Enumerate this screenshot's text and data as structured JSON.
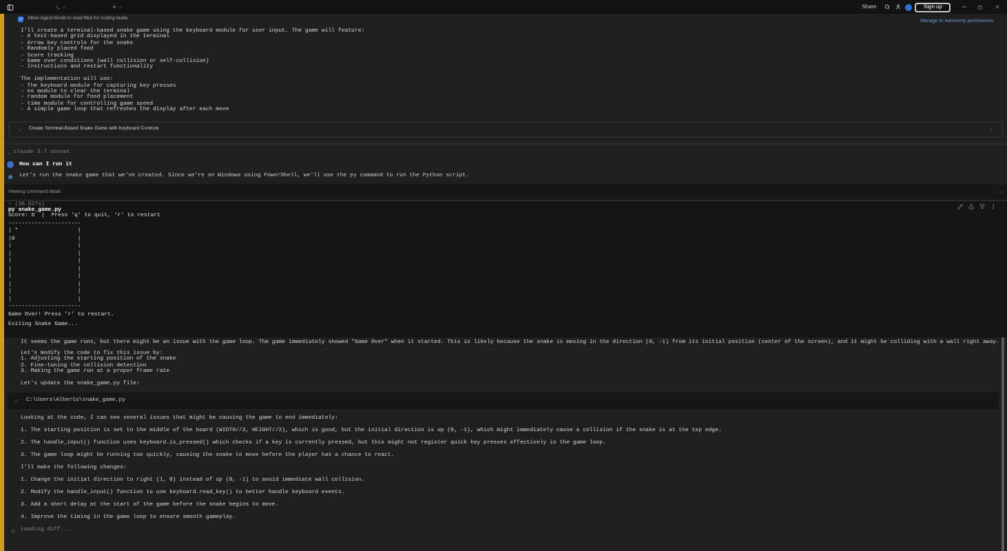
{
  "title_bar": {
    "share": "Share",
    "sign_up": "Sign up"
  },
  "permission": {
    "checkbox_label": "Allow Agent Mode to read files for coding tasks",
    "checked": true,
    "link": "Manage AI Autonomy permissions"
  },
  "plan": {
    "intro": [
      "I'll create a terminal-based snake game using the keyboard module for user input. The game will feature:",
      "- A text-based grid displayed in the terminal",
      "- Arrow key controls for the snake",
      "- Randomly placed food",
      "- Score tracking",
      "- Game over conditions (wall collision or self-collision)",
      "- Instructions and restart functionality"
    ],
    "implementation": [
      "The implementation will use:",
      "- The keyboard module for capturing key presses",
      "- os module to clear the terminal",
      "- random module for food placement",
      "- time module for controlling game speed",
      "- A simple game loop that refreshes the display after each move"
    ]
  },
  "task": {
    "label": "Create Terminal-Based Snake Game with Keyboard Controls",
    "done": true
  },
  "model": "claude 3.7 sonnet",
  "question": "How can I run it",
  "answer": "Let's run the snake game that we've created. Since we're on Windows using PowerShell, we'll use the py command to run the Python script.",
  "command_bar": "Viewing command detail",
  "terminal": {
    "duration": "~ (36.527s)",
    "command": "py snake_game.py",
    "score": "Score: 0  |  Press 'q' to quit, 'r' to restart",
    "board": [
      "----------------------",
      "| *                  |",
      "|0                   |",
      "|                    |",
      "|                    |",
      "|                    |",
      "|                    |",
      "|                    |",
      "|                    |",
      "|                    |",
      "|                    |",
      "----------------------"
    ],
    "game_over": "Game Over! Press 'r' to restart.",
    "exit_message": "Exiting Snake Game..."
  },
  "analysis": {
    "intro": "It seems the game runs, but there might be an issue with the game loop. The game immediately showed \"Game Over\" when it started. This is likely because the snake is moving in the direction (0, -1) from its initial position (center of the screen), and it might be colliding with a wall right away.",
    "fix_plan": [
      "Let's modify the code to fix this issue by:",
      "1. Adjusting the starting position of the snake",
      "2. Fine-tuning the collision detection",
      "3. Making the game run at a proper frame rate"
    ],
    "update": "Let's update the snake_game.py file:",
    "file": {
      "path": "C:\\Users\\Alberto\\snake_game.py",
      "done": true
    },
    "issues_intro": "Looking at the code, I can see several issues that might be causing the game to end immediately:",
    "issues": [
      "1. The starting position is set to the middle of the board (WIDTH//2, HEIGHT//2), which is good, but the initial direction is up (0, -1), which might immediately cause a collision if the snake is at the top edge.",
      "2. The handle_input() function uses keyboard.is_pressed() which checks if a key is currently pressed, but this might not register quick key presses effectively in the game loop.",
      "3. The game loop might be running too quickly, causing the snake to move before the player has a chance to react."
    ],
    "changes_intro": "I'll make the following changes:",
    "changes": [
      "1. Change the initial direction to right (1, 0) instead of up (0, -1) to avoid immediate wall collision.",
      "2. Modify the handle_input() function to use keyboard.read_key() to better handle keyboard events.",
      "3. Add a short delay at the start of the game before the snake begins to move.",
      "4. Improve the timing in the game loop to ensure smooth gameplay."
    ],
    "loading": "Loading diff..."
  }
}
